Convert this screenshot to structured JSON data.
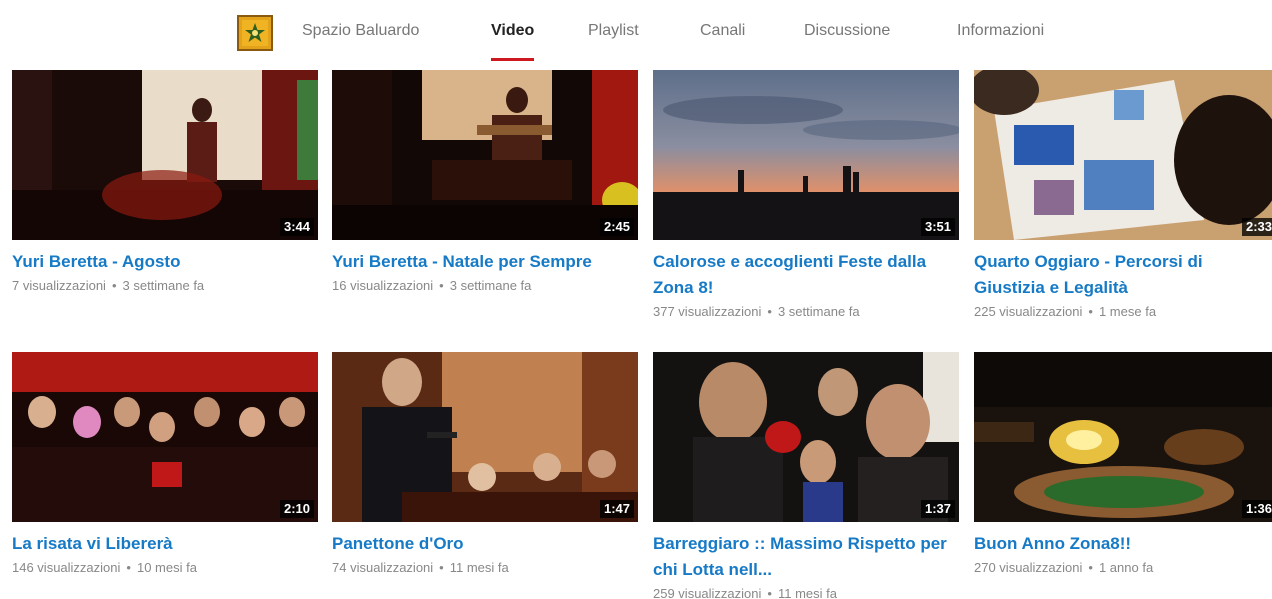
{
  "channel": {
    "name": "Spazio Baluardo",
    "avatar_icon": "channel-logo-icon"
  },
  "tabs": [
    {
      "label": "Spazio Baluardo"
    },
    {
      "label": "Video",
      "active": true
    },
    {
      "label": "Playlist"
    },
    {
      "label": "Canali"
    },
    {
      "label": "Discussione"
    },
    {
      "label": "Informazioni"
    }
  ],
  "meta_separator": "•",
  "videos": [
    {
      "title": "Yuri Beretta - Agosto",
      "duration": "3:44",
      "views": "7 visualizzazioni",
      "age": "3 settimane fa"
    },
    {
      "title": "Yuri Beretta - Natale per Sempre",
      "duration": "2:45",
      "views": "16 visualizzazioni",
      "age": "3 settimane fa"
    },
    {
      "title": "Calorose e accoglienti Feste dalla Zona 8!",
      "duration": "3:51",
      "views": "377 visualizzazioni",
      "age": "3 settimane fa"
    },
    {
      "title": "Quarto Oggiaro - Percorsi di Giustizia e Legalità",
      "duration": "2:33",
      "views": "225 visualizzazioni",
      "age": "1 mese fa"
    },
    {
      "title": "La risata vi Libererà",
      "duration": "2:10",
      "views": "146 visualizzazioni",
      "age": "10 mesi fa"
    },
    {
      "title": "Panettone d'Oro",
      "duration": "1:47",
      "views": "74 visualizzazioni",
      "age": "11 mesi fa"
    },
    {
      "title": "Barreggiaro :: Massimo Rispetto per chi Lotta nell...",
      "duration": "1:37",
      "views": "259 visualizzazioni",
      "age": "11 mesi fa"
    },
    {
      "title": "Buon Anno Zona8!!",
      "duration": "1:36",
      "views": "270 visualizzazioni",
      "age": "1 anno fa"
    }
  ],
  "colors": {
    "link": "#167ac6",
    "tab_underline": "#cc181e",
    "meta_text": "#888888"
  }
}
